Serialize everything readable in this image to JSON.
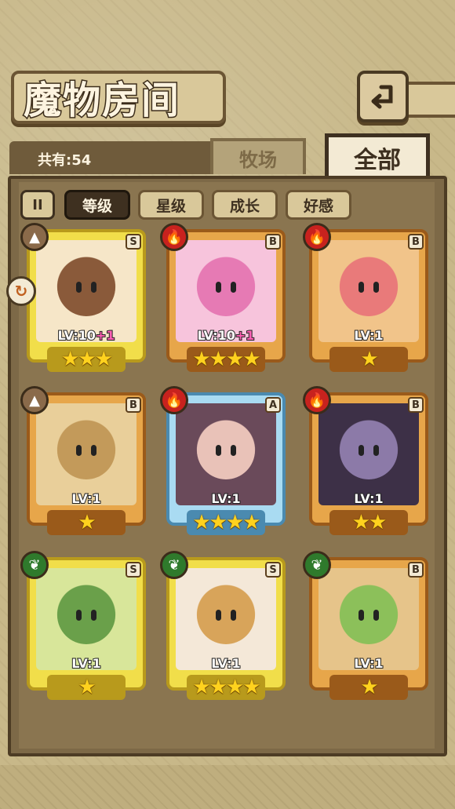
{
  "header": {
    "title": "魔物房间",
    "back_icon": "back-arrow-icon"
  },
  "summary": {
    "count_text": "共有:54"
  },
  "tabs": [
    {
      "label": "牧场",
      "active": false
    },
    {
      "label": "全部",
      "active": true
    }
  ],
  "sort": {
    "pause_label": "II",
    "buttons": [
      {
        "label": "等级",
        "active": true
      },
      {
        "label": "星级",
        "active": false
      },
      {
        "label": "成长",
        "active": false
      },
      {
        "label": "好感",
        "active": false
      }
    ]
  },
  "monsters": [
    {
      "level": "LV:10",
      "bonus": "+1",
      "stars": "★★★",
      "rank": "S",
      "element": "earth",
      "frame": "gold"
    },
    {
      "level": "LV:10",
      "bonus": "+1",
      "stars": "★★★★",
      "rank": "B",
      "element": "fire",
      "frame": "orange"
    },
    {
      "level": "LV:1",
      "bonus": "",
      "stars": "★",
      "rank": "B",
      "element": "fire",
      "frame": "orange"
    },
    {
      "level": "LV:1",
      "bonus": "",
      "stars": "★",
      "rank": "B",
      "element": "earth",
      "frame": "orange"
    },
    {
      "level": "LV:1",
      "bonus": "",
      "stars": "★★★★",
      "rank": "A",
      "element": "fire",
      "frame": "blue"
    },
    {
      "level": "LV:1",
      "bonus": "",
      "stars": "★★",
      "rank": "B",
      "element": "fire",
      "frame": "orange"
    },
    {
      "level": "LV:1",
      "bonus": "",
      "stars": "★",
      "rank": "S",
      "element": "wood",
      "frame": "gold"
    },
    {
      "level": "LV:1",
      "bonus": "",
      "stars": "★★★★",
      "rank": "S",
      "element": "wood",
      "frame": "gold"
    },
    {
      "level": "LV:1",
      "bonus": "",
      "stars": "★",
      "rank": "B",
      "element": "wood",
      "frame": "orange"
    }
  ],
  "colors": {
    "fire": "#c8221e",
    "earth": "#8a6a4a",
    "wood": "#2f7a2c",
    "gold_frame": "#e8d23a",
    "orange_frame": "#d98a2a",
    "blue_frame": "#8cc8e8"
  }
}
